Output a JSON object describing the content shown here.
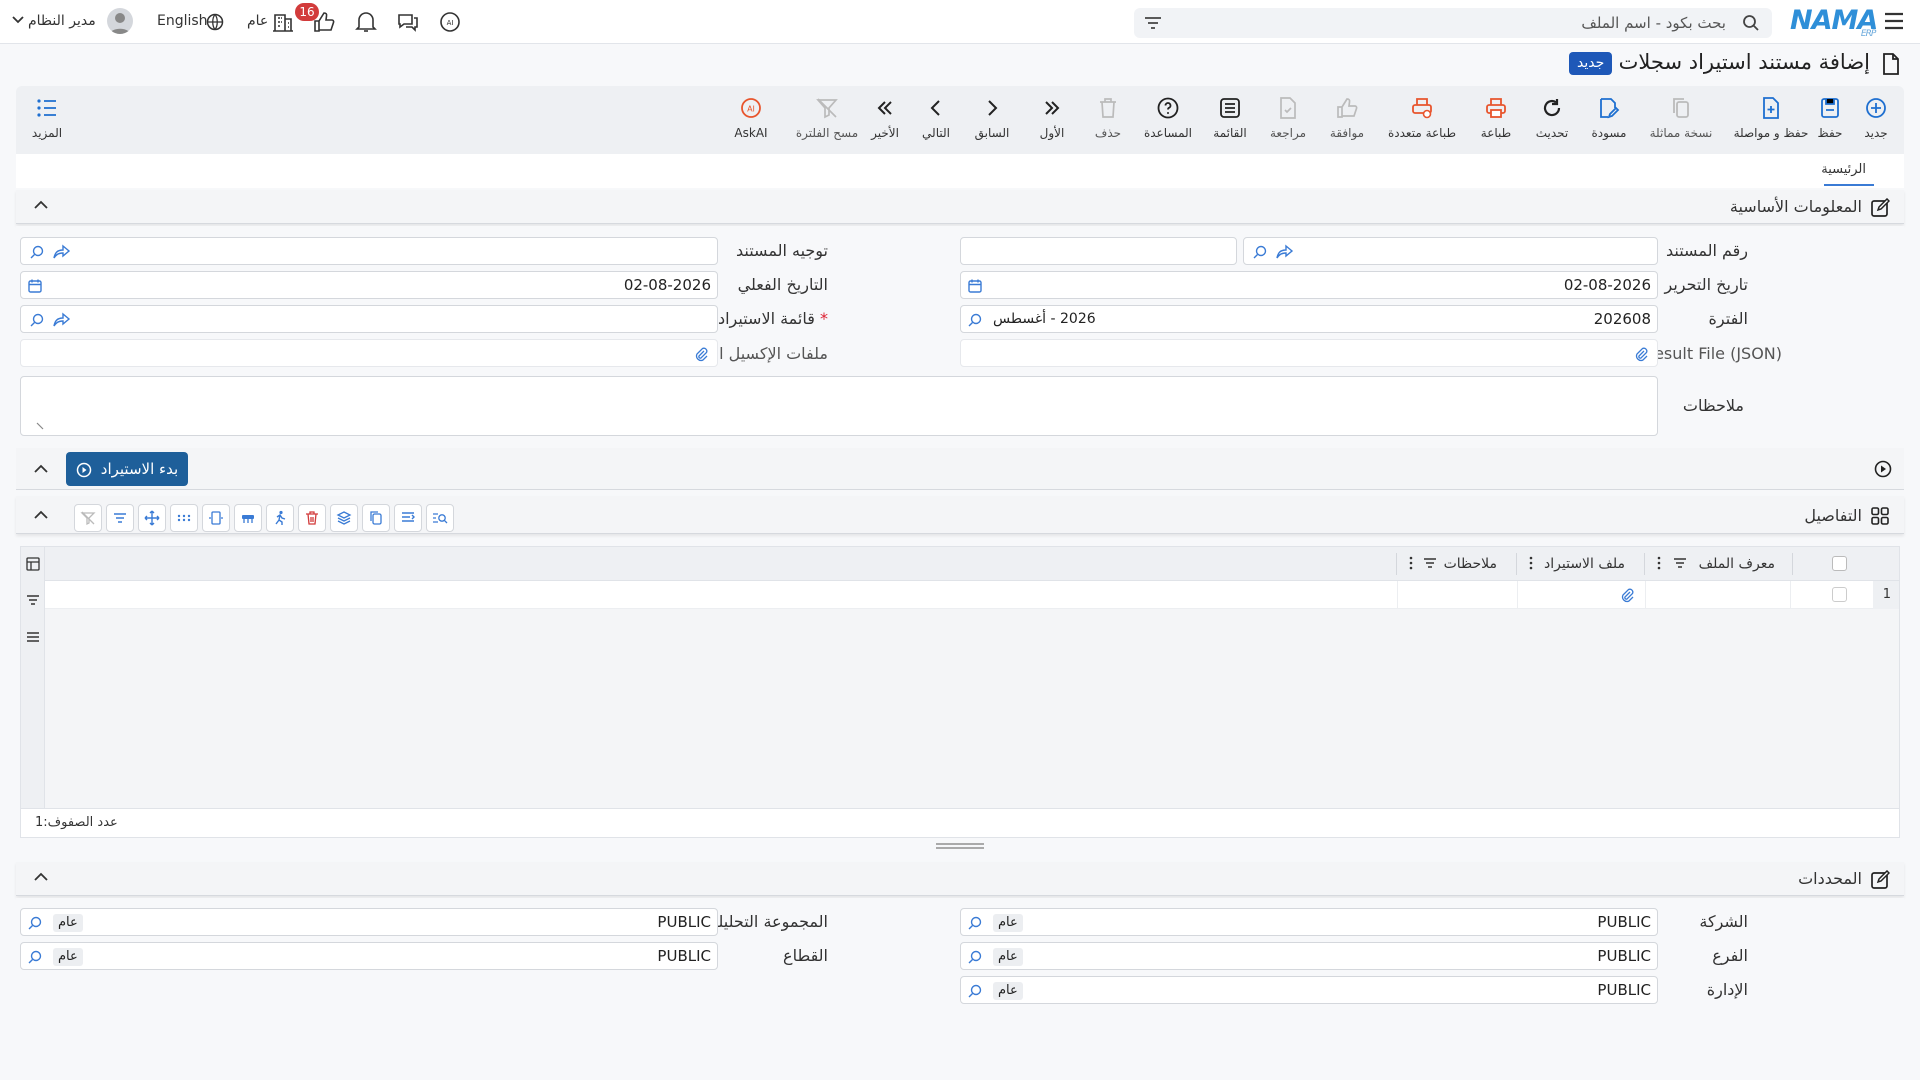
{
  "topbar": {
    "search_placeholder": "بحث بكود - اسم الملف",
    "logo_main": "NAMA",
    "logo_sub": "ERP",
    "language": "English",
    "scope": "عام",
    "notifications_count": "16",
    "user_name": "مدير النظام"
  },
  "page": {
    "title": "إضافة مستند استيراد سجلات",
    "badge": "جديد"
  },
  "toolbar": {
    "new": "جديد",
    "save": "حفظ",
    "save_continue": "حفظ و مواصلة",
    "duplicate": "نسخة مماثلة",
    "draft": "مسودة",
    "refresh": "تحديث",
    "print": "طباعة",
    "multi_print": "طباعة متعددة",
    "approve": "موافقة",
    "review": "مراجعة",
    "list": "القائمة",
    "help": "المساعدة",
    "delete": "حذف",
    "first": "الأول",
    "previous": "السابق",
    "next": "التالي",
    "last": "الأخير",
    "clear_filter": "مسح الفلترة",
    "askai": "AskAI",
    "more": "المزيد"
  },
  "tabs": {
    "main": "الرئيسية"
  },
  "basic_info": {
    "title": "المعلومات الأساسية",
    "doc_number_label": "رقم المستند",
    "doc_number_value": "",
    "doc_direction_label": "توجيه المستند",
    "creation_date_label": "تاريخ التحرير",
    "creation_date_value": "02-08-2026",
    "actual_date_label": "التاريخ الفعلي",
    "actual_date_value": "02-08-2026",
    "period_label": "الفترة",
    "period_code": "202608",
    "period_name": "2026 - أغسطس",
    "import_list_label": "قائمة الاستيراد",
    "required_mark": "*",
    "result_file_label": "Result File (JSON)",
    "excel_files_label": "ملفات الإكسيل الناتجة",
    "notes_label": "ملاحظات"
  },
  "import_action": {
    "button": "بدء الاستيراد"
  },
  "details": {
    "title": "التفاصيل",
    "columns": [
      "معرف الملف",
      "ملف الاستيراد",
      "ملاحظات"
    ],
    "rows": [
      {
        "index": "1"
      }
    ],
    "row_count_label": "عدد الصفوف:",
    "row_count": "1"
  },
  "dimensions": {
    "title": "المحددات",
    "company_label": "الشركة",
    "company_value": "PUBLIC",
    "company_tag": "عام",
    "branch_label": "الفرع",
    "branch_value": "PUBLIC",
    "branch_tag": "عام",
    "department_label": "الإدارة",
    "department_value": "PUBLIC",
    "department_tag": "عام",
    "analysis_group_label": "المجموعة التحليلية",
    "analysis_group_value": "PUBLIC",
    "analysis_group_tag": "عام",
    "sector_label": "القطاع",
    "sector_value": "PUBLIC",
    "sector_tag": "عام"
  },
  "colors": {
    "accent": "#1e58b8",
    "print_orange": "#e8552d",
    "logo_blue": "#2f8fd8",
    "danger": "#d23b3b"
  }
}
